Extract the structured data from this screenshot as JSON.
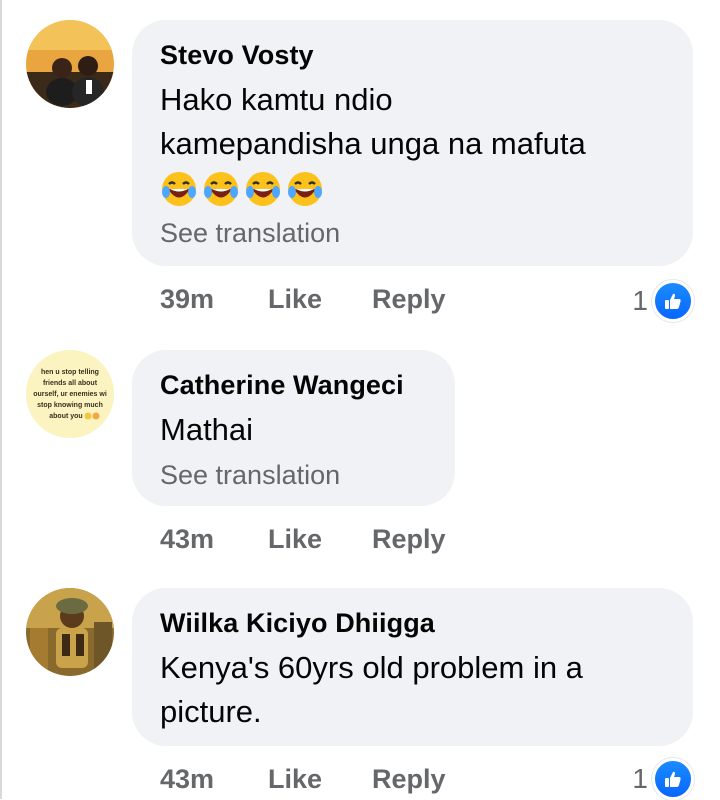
{
  "comments": [
    {
      "author": "Stevo Vosty",
      "text_lines": [
        "Hako kamtu ndio",
        "kamepandisha unga na mafuta"
      ],
      "emoji": [
        "laughing-tears-emoji",
        "laughing-tears-emoji",
        "laughing-tears-emoji",
        "laughing-tears-emoji"
      ],
      "see_translation": "See translation",
      "time": "39m",
      "like_label": "Like",
      "reply_label": "Reply",
      "reaction_count": "1"
    },
    {
      "author": "Catherine Wangeci",
      "text_lines": [
        "Mathai"
      ],
      "see_translation": "See translation",
      "time": "43m",
      "like_label": "Like",
      "reply_label": "Reply",
      "avatar_text": [
        "hen u stop telling",
        "friends all about",
        "ourself, ur enemies wi",
        "stop knowing much",
        "about you"
      ]
    },
    {
      "author": "Wiilka Kiciyo Dhiigga",
      "text_lines": [
        "Kenya's 60yrs old problem in a",
        "picture."
      ],
      "time": "43m",
      "like_label": "Like",
      "reply_label": "Reply",
      "reaction_count": "1"
    }
  ],
  "colors": {
    "bubble": "#f0f2f5",
    "secondary_text": "#65676b",
    "like_blue": "#0866ff"
  }
}
